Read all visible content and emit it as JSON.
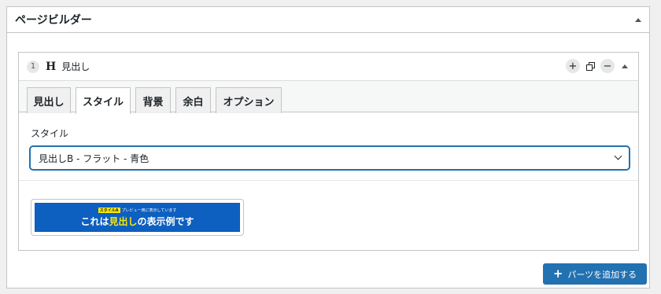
{
  "metabox": {
    "title": "ページビルダー"
  },
  "part": {
    "number": "1",
    "type_icon": "H",
    "name": "見出し",
    "controls": {
      "add_icon": "plus-icon",
      "copy_icon": "copy-icon",
      "remove_icon": "minus-icon",
      "collapse_icon": "collapse-arrow-icon"
    }
  },
  "tabs": [
    {
      "label": "見出し"
    },
    {
      "label": "スタイル"
    },
    {
      "label": "背景"
    },
    {
      "label": "余白"
    },
    {
      "label": "オプション"
    }
  ],
  "active_tab": "スタイル",
  "style_field": {
    "label": "スタイル",
    "selected": "見出しB - フラット - 青色"
  },
  "preview": {
    "badge": "スタイルA",
    "caption": "プレビュー用に表示しています",
    "text_before": "これは",
    "text_highlight": "見出し",
    "text_after": "の表示例です",
    "colors": {
      "background": "#0d5fc0",
      "highlight": "#f5e90a"
    }
  },
  "add_button": {
    "label": "パーツを追加する"
  },
  "colors": {
    "accent": "#2271b1",
    "border": "#c3c4c7"
  }
}
